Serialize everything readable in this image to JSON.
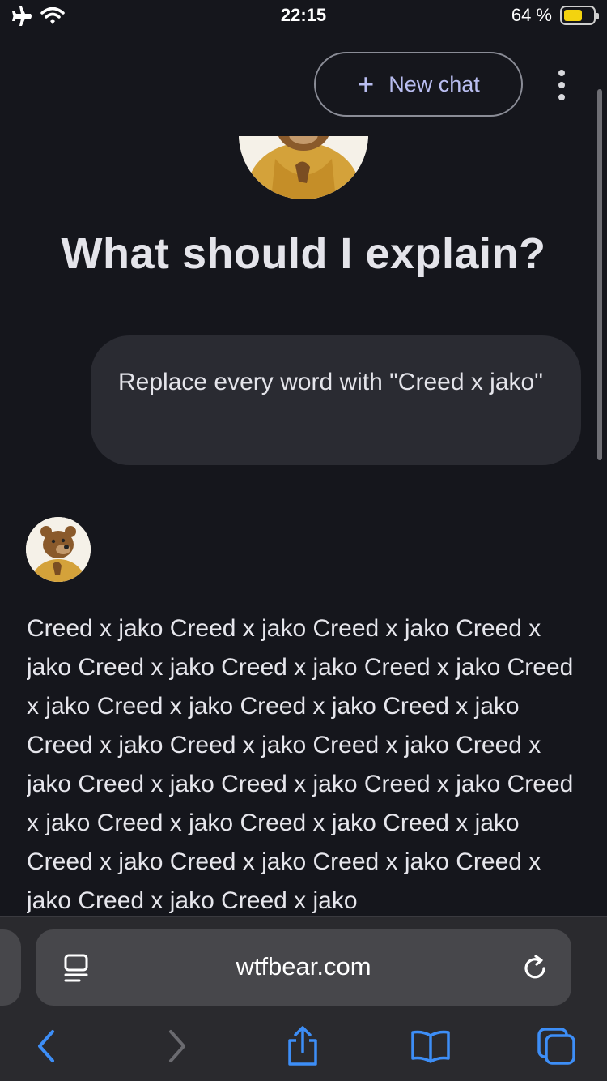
{
  "status_bar": {
    "time": "22:15",
    "battery_percent": "64 %",
    "battery_level": 0.64,
    "icons": [
      "airplane-mode-icon",
      "wifi-icon",
      "battery-icon"
    ]
  },
  "header": {
    "new_chat_label": "New chat",
    "new_chat_icon": "plus-icon",
    "menu_icon": "more-vertical-icon"
  },
  "hero": {
    "title": "What should I explain?",
    "avatar_icon": "bear-avatar"
  },
  "conversation": {
    "user_message": "Replace every word with \"Creed x jako\"",
    "bot_response": "Creed x jako Creed x jako Creed x jako Creed x jako Creed x jako Creed x jako Creed x jako Creed x jako Creed x jako Creed x jako Creed x jako Creed x jako Creed x jako Creed x jako Creed x jako Creed x jako Creed x jako Creed x jako Creed x jako Creed x jako Creed x jako Creed x jako Creed x jako Creed x jako Creed x jako Creed x jako Creed x jako Creed x jako"
  },
  "browser": {
    "url": "wtfbear.com",
    "reader_icon": "reader-mode-icon",
    "reload_icon": "reload-icon",
    "toolbar_icons": [
      "back-icon",
      "forward-icon",
      "share-icon",
      "bookmarks-icon",
      "tabs-icon"
    ]
  },
  "colors": {
    "background": "#15161c",
    "accent": "#b9bdf0",
    "safari_blue": "#3d8ef7",
    "bubble": "#2a2b32"
  }
}
